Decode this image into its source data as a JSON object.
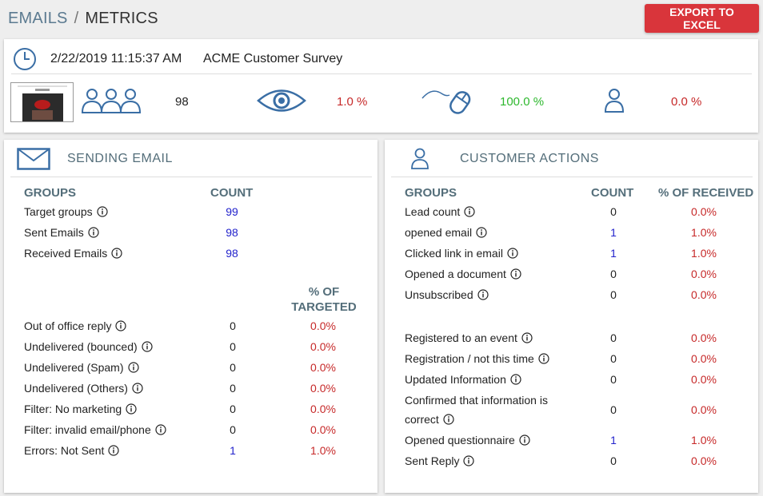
{
  "breadcrumb": {
    "part1": "EMAILS",
    "separator": "/",
    "part2": "METRICS"
  },
  "header": {
    "export_label": "EXPORT TO EXCEL"
  },
  "summary": {
    "datetime": "2/22/2019  11:15:37 AM",
    "survey_name": "ACME Customer Survey",
    "recipients": "98",
    "opened_pct": "1.0 %",
    "clicked_pct": "100.0 %",
    "other_pct": "0.0 %"
  },
  "sending": {
    "title": "SENDING EMAIL",
    "col_groups": "GROUPS",
    "col_count": "COUNT",
    "col_pct_line1": "% OF",
    "col_pct_line2": "TARGETED",
    "rows": [
      {
        "label": "Target groups",
        "count": "99"
      },
      {
        "label": "Sent Emails",
        "count": "98"
      },
      {
        "label": "Received Emails",
        "count": "98"
      }
    ],
    "rows2": [
      {
        "label": "Out of office reply",
        "count": "0",
        "pct": "0.0%"
      },
      {
        "label": "Undelivered (bounced)",
        "count": "0",
        "pct": "0.0%"
      },
      {
        "label": "Undelivered (Spam)",
        "count": "0",
        "pct": "0.0%"
      },
      {
        "label": "Undelivered (Others)",
        "count": "0",
        "pct": "0.0%"
      },
      {
        "label": "Filter: No marketing",
        "count": "0",
        "pct": "0.0%"
      },
      {
        "label": "Filter: invalid email/phone",
        "count": "0",
        "pct": "0.0%"
      },
      {
        "label": "Errors: Not Sent",
        "count": "1",
        "pct": "1.0%"
      }
    ]
  },
  "actions": {
    "title": "CUSTOMER ACTIONS",
    "col_groups": "GROUPS",
    "col_count": "COUNT",
    "col_pct": "% OF RECEIVED",
    "rows": [
      {
        "label": "Lead count",
        "count": "0",
        "pct": "0.0%"
      },
      {
        "label": "opened email",
        "count": "1",
        "pct": "1.0%"
      },
      {
        "label": "Clicked link in email",
        "count": "1",
        "pct": "1.0%"
      },
      {
        "label": "Opened a document",
        "count": "0",
        "pct": "0.0%"
      },
      {
        "label": "Unsubscribed",
        "count": "0",
        "pct": "0.0%"
      }
    ],
    "rows2": [
      {
        "label": "Registered to an event",
        "count": "0",
        "pct": "0.0%"
      },
      {
        "label": "Registration / not this time",
        "count": "0",
        "pct": "0.0%"
      },
      {
        "label": "Updated Information",
        "count": "0",
        "pct": "0.0%"
      },
      {
        "label": "Confirmed that information is",
        "label2": "correct",
        "count": "0",
        "pct": "0.0%"
      },
      {
        "label": "Opened questionnaire",
        "count": "1",
        "pct": "1.0%"
      },
      {
        "label": "Sent Reply",
        "count": "0",
        "pct": "0.0%"
      }
    ]
  },
  "colors": {
    "accent": "#546e7a",
    "button": "#d9353b",
    "negative": "#c62828",
    "positive": "#2eb82e",
    "link": "#2222cc"
  }
}
